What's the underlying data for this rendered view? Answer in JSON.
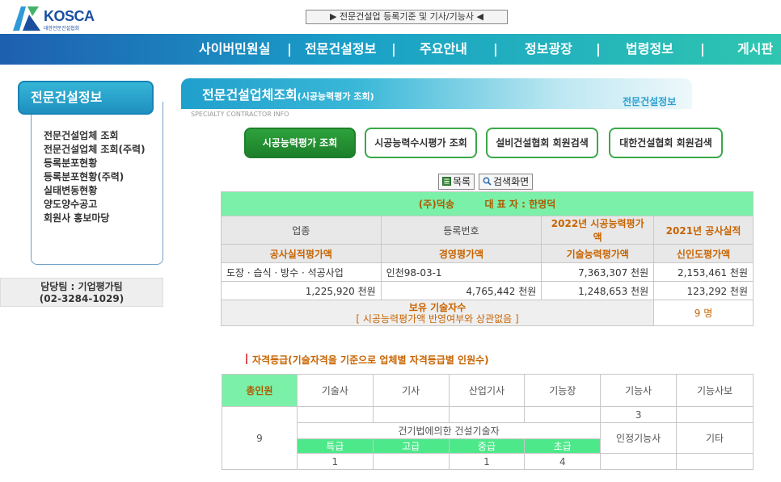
{
  "logo": {
    "name": "KOSCA",
    "sub": "대한전문건설협회"
  },
  "top_banner": "▶ 전문건설업 등록기준 및 기사/기능사 ◀",
  "nav": [
    "사이버민원실",
    "전문건설정보",
    "주요안내",
    "정보광장",
    "법령정보",
    "게시판"
  ],
  "sidebar": {
    "title": "전문건설정보",
    "items": [
      "전문건설업체 조회",
      "전문건설업체 조회(주력)",
      "등록분포현황",
      "등록분포현황(주력)",
      "실태변동현황",
      "양도양수공고",
      "회원사 홍보마당"
    ],
    "contact_line1": "담당팀 : 기업평가팀",
    "contact_line2": "(02-3284-1029)"
  },
  "page": {
    "title": "전문건설업체조회",
    "title_sub": "(시공능력평가 조회)",
    "title_right": "전문건설정보",
    "title_eng": "SPECIALTY CONTRACTOR INFO"
  },
  "tabs": [
    "시공능력평가 조회",
    "시공능력수시평가 조회",
    "설비건설협회 회원검색",
    "대한건설협회 회원검색"
  ],
  "buttons": {
    "list": "목록",
    "search": "검색화면"
  },
  "company": {
    "name": "(주)덕송",
    "rep_label": "대 표 자 :",
    "rep_name": "한명덕",
    "headers1": [
      "업종",
      "등록번호",
      "2022년 시공능력평가액",
      "2021년 공사실적"
    ],
    "headers2": [
      "공사실적평가액",
      "경영평가액",
      "기술능력평가액",
      "신인도평가액"
    ],
    "row1": [
      "도장 · 습식 · 방수 · 석공사업",
      "인천98-03-1",
      "7,363,307 천원",
      "2,153,461 천원"
    ],
    "row2": [
      "1,225,920 천원",
      "4,765,442 천원",
      "1,248,653 천원",
      "123,292 천원"
    ],
    "tech_label": "보유 기술자수",
    "tech_note": "[ 시공능력평가액 반영여부와 상관없음 ]",
    "tech_count": "9 명"
  },
  "qualification": {
    "title": "자격등급(기술자격을 기준으로 업체별 자격등급별 인원수)",
    "headers": [
      "총인원",
      "기술사",
      "기사",
      "산업기사",
      "기능장",
      "기능사",
      "기능사보"
    ],
    "total": "9",
    "row1": [
      "",
      "",
      "",
      "",
      "3",
      ""
    ],
    "law_label": "건기법에의한 건설기술자",
    "grades": [
      "특급",
      "고급",
      "중급",
      "초급"
    ],
    "grade_values": [
      "1",
      "",
      "1",
      "4"
    ],
    "cert_label": "인정기능사",
    "etc_label": "기타"
  },
  "colors": {
    "nav_start": "#1e5fb0",
    "nav_end": "#2ec6b0",
    "green": "#7af0a8",
    "button_green": "#2ea23c",
    "orange": "#c86400"
  }
}
